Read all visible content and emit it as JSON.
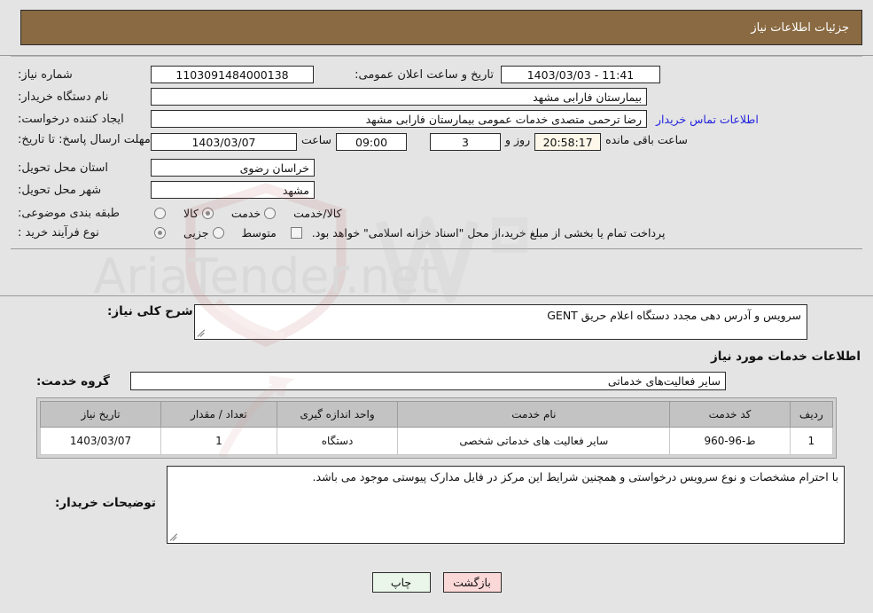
{
  "header": {
    "title": "جزئیات اطلاعات نیاز"
  },
  "top_form": {
    "need_number_label": "شماره نیاز:",
    "need_number_value": "1103091484000138",
    "announce_datetime_label": "تاریخ و ساعت اعلان عمومی:",
    "announce_datetime_value": "11:41 - 1403/03/03",
    "buyer_org_label": "نام دستگاه خریدار:",
    "buyer_org_value": "بیمارستان فارابی مشهد",
    "creator_label": "ایجاد کننده درخواست:",
    "creator_value": "رضا ترحمی متصدی خدمات عمومی بیمارستان فارابی مشهد",
    "contact_link": "اطلاعات تماس خریدار",
    "deadline_label": "مهلت ارسال پاسخ: تا تاریخ:",
    "deadline_date": "1403/03/07",
    "deadline_time_label": "ساعت",
    "deadline_time": "09:00",
    "days_remaining": "3",
    "days_word": "روز و",
    "countdown": "20:58:17",
    "countdown_suffix": "ساعت باقی مانده",
    "province_label": "استان محل تحویل:",
    "province_value": "خراسان رضوی",
    "city_label": "شهر محل تحویل:",
    "city_value": "مشهد",
    "classification_label": "طبقه بندی موضوعی:",
    "classification_options": [
      {
        "label": "کالا",
        "selected": false
      },
      {
        "label": "خدمت",
        "selected": true
      },
      {
        "label": "کالا/خدمت",
        "selected": false
      }
    ],
    "process_label": "نوع فرآیند خرید :",
    "process_options": [
      {
        "label": "جزیی",
        "selected": true
      },
      {
        "label": "متوسط",
        "selected": false
      }
    ],
    "treasury_checkbox_label": "پرداخت تمام یا بخشی از مبلغ خرید،از محل \"اسناد خزانه اسلامی\" خواهد بود.",
    "treasury_checked": false
  },
  "description": {
    "label": "شرح کلی نیاز:",
    "value": "سرویس و آدرس دهی مجدد دستگاه اعلام حریق GENT"
  },
  "services_section": {
    "heading": "اطلاعات خدمات مورد نیاز",
    "group_label": "گروه خدمت:",
    "group_value": "سایر فعالیت‌های خدماتی",
    "table": {
      "columns": [
        "ردیف",
        "کد خدمت",
        "نام خدمت",
        "واحد اندازه گیری",
        "تعداد / مقدار",
        "تاریخ نیاز"
      ],
      "rows": [
        {
          "row_no": "1",
          "service_code": "ط-96-960",
          "service_name": "سایر فعالیت های خدماتی شخصی",
          "unit": "دستگاه",
          "quantity": "1",
          "need_date": "1403/03/07"
        }
      ]
    }
  },
  "buyer_notes": {
    "label": "توضیحات خریدار:",
    "value": "با احترام مشخصات و نوع سرویس درخواستی و همچنین شرایط این مرکز در فایل مدارک پیوستی موجود می باشد."
  },
  "buttons": {
    "print": "چاپ",
    "back": "بازگشت"
  },
  "colors": {
    "header_bg": "#8a6a42",
    "link": "#2222dd",
    "countdown_bg": "#fdf8ea",
    "print_bg": "#eaf6ea",
    "back_bg": "#fbd8d8",
    "table_header_bg": "#c3c3c3",
    "page_bg": "#e4e4e4"
  },
  "watermark": {
    "text": "AriaTender.net"
  }
}
